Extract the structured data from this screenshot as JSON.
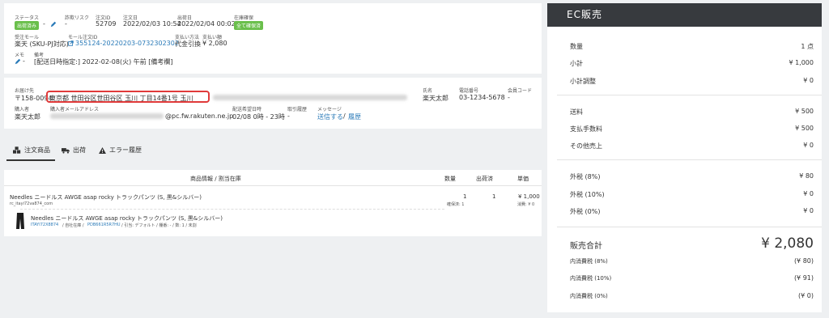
{
  "order": {
    "status_label": "ステータス",
    "status_value": "出荷済み",
    "status_suffix": "-",
    "risk_label": "詐欺リスク",
    "risk_value": "-",
    "order_id_label": "注文ID",
    "order_id_value": "52709",
    "order_date_label": "注文日",
    "order_date_value": "2022/02/03 10:54",
    "ship_date_label": "出荷日",
    "ship_date_value": "2022/02/04 00:02",
    "stock_label": "在庫確保",
    "stock_value": "全て確保済",
    "mall_label": "受注モール",
    "mall_value": "楽天 (SKU-PJ対応)",
    "mall_order_label": "モール注文ID",
    "mall_order_value": "355124-20220203-0732302302",
    "payment_label": "支払い方法",
    "payment_value": "代金引換",
    "amount_label": "支払い額",
    "amount_value": "¥ 2,080",
    "memo_label": "メモ",
    "memo_value": "-",
    "note_label": "備考",
    "note_value": "[配送日時指定:] 2022-02-08(火) 午前 [備考欄]"
  },
  "shipping": {
    "address_label": "お届け先",
    "postal": "〒158-0094",
    "address": "東京都 世田谷区世田谷区 玉川    丁目14番1号 玉川",
    "name_label": "氏名",
    "name_value": "楽天太郎",
    "phone_label": "電話番号",
    "phone_value": "03-1234-5678",
    "member_label": "会員コード",
    "member_value": "-",
    "buyer_label": "購入者",
    "buyer_value": "楽天太郎",
    "email_label": "購入者メールアドレス",
    "email_domain": "@pc.fw.rakuten.ne.jp",
    "delivery_label": "配送希望日時",
    "delivery_value": "02/08 0時 - 23時",
    "history_label": "取引履歴",
    "history_value": "-",
    "message_label": "メッセージ",
    "message_send": "送信する",
    "message_sep": "/",
    "message_history": "履歴"
  },
  "tabs": [
    {
      "label": "注文商品",
      "icon": "boxes-icon"
    },
    {
      "label": "出荷",
      "icon": "truck-icon"
    },
    {
      "label": "エラー履歴",
      "icon": "warning-icon"
    }
  ],
  "table": {
    "col_product": "商品情報 / 割当在庫",
    "col_qty": "数量",
    "col_shipped": "出荷済",
    "col_price": "単価",
    "row": {
      "name": "Needles ニードルス AWGE asap rocky トラックパンツ (S, 黒&シルバー)",
      "code": "rc_itayi72va874_com",
      "qty": "1",
      "qty_sub": "確保済: 1",
      "shipped": "1",
      "price": "¥ 1,000",
      "tax": "消費: ¥ 0"
    },
    "sub": {
      "name": "Needles ニードルス AWGE asap rocky トラックパンツ (S, 黒&シルバー)",
      "sku": "ITAYI72X8874",
      "sep1": "/ 自社在庫 /",
      "barcode": "PDB661R5R7HU",
      "detail": "/ 引当: デフォルト / 棚番: - / 数: 1 / 未割"
    }
  },
  "summary": {
    "title": "EC販売",
    "rows1": [
      {
        "k": "数量",
        "v": "1 点"
      },
      {
        "k": "小計",
        "v": "¥ 1,000"
      },
      {
        "k": "小計調整",
        "v": "¥ 0"
      }
    ],
    "rows2": [
      {
        "k": "送料",
        "v": "¥ 500"
      },
      {
        "k": "支払手数料",
        "v": "¥ 500"
      },
      {
        "k": "その他売上",
        "v": "¥ 0"
      }
    ],
    "rows3": [
      {
        "k": "外税 (8%)",
        "v": "¥ 80"
      },
      {
        "k": "外税 (10%)",
        "v": "¥ 0"
      },
      {
        "k": "外税 (0%)",
        "v": "¥ 0"
      }
    ],
    "total_label": "販売合計",
    "total_value": "¥ 2,080",
    "rows4": [
      {
        "k": "内消費税 (8%)",
        "v": "(¥ 80)"
      },
      {
        "k": "内消費税 (10%)",
        "v": "(¥ 91)"
      },
      {
        "k": "内消費税 (0%)",
        "v": "(¥ 0)"
      }
    ]
  },
  "colors": {
    "badge_green": "#6abf4b",
    "highlight_red": "#e03a3a",
    "link_blue": "#2a7ab8",
    "header_dark": "#373a3e"
  }
}
